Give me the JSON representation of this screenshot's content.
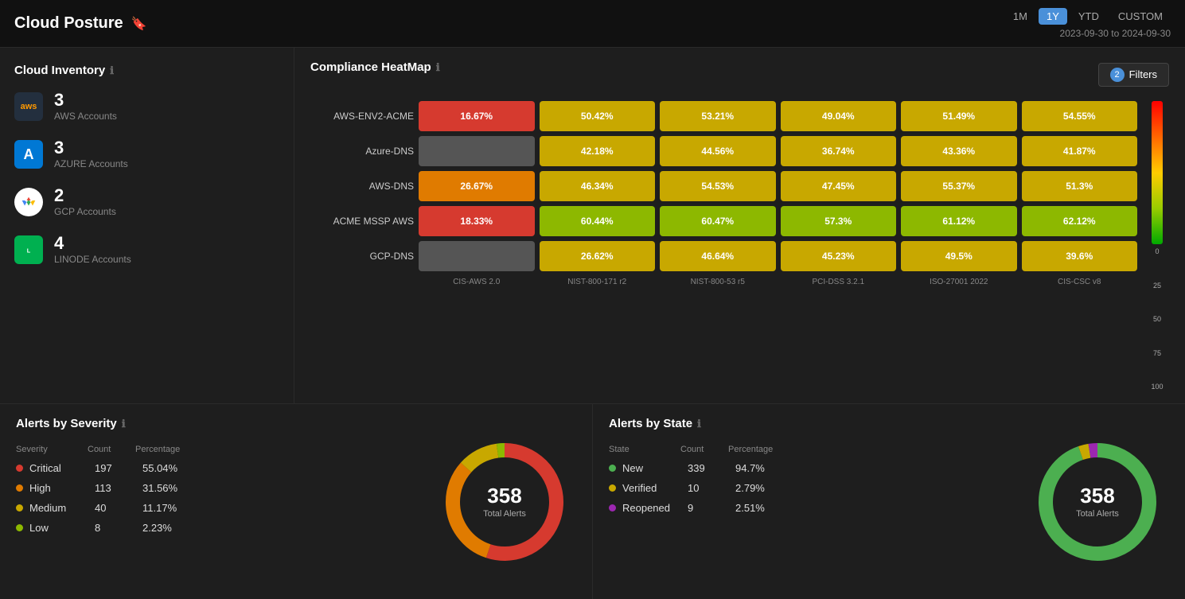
{
  "header": {
    "title": "Cloud Posture",
    "date_range": "2023-09-30 to 2024-09-30",
    "time_filters": [
      "1M",
      "1Y",
      "YTD",
      "CUSTOM"
    ],
    "active_filter": "1Y"
  },
  "cloud_inventory": {
    "title": "Cloud Inventory",
    "accounts": [
      {
        "id": "aws",
        "name": "AWS Accounts",
        "count": "3",
        "color": "#232f3e",
        "text_color": "#ff9900"
      },
      {
        "id": "azure",
        "name": "AZURE Accounts",
        "count": "3",
        "color": "#0078d4",
        "text_color": "#fff"
      },
      {
        "id": "gcp",
        "name": "GCP Accounts",
        "count": "2",
        "color": "#fff",
        "text_color": "#4285f4"
      },
      {
        "id": "linode",
        "name": "LINODE Accounts",
        "count": "4",
        "color": "#00b050",
        "text_color": "#fff"
      }
    ]
  },
  "compliance_heatmap": {
    "title": "Compliance HeatMap",
    "filters_label": "Filters",
    "filters_count": "2",
    "columns": [
      "CIS-AWS 2.0",
      "NIST-800-171 r2",
      "NIST-800-53 r5",
      "PCI-DSS 3.2.1",
      "ISO-27001 2022",
      "CIS-CSC v8"
    ],
    "rows": [
      {
        "label": "AWS-ENV2-ACME",
        "cells": [
          {
            "value": "16.67%",
            "color": "#d63a2f"
          },
          {
            "value": "50.42%",
            "color": "#c8a800"
          },
          {
            "value": "53.21%",
            "color": "#c8a800"
          },
          {
            "value": "49.04%",
            "color": "#c8a800"
          },
          {
            "value": "51.49%",
            "color": "#c8a800"
          },
          {
            "value": "54.55%",
            "color": "#c8a800"
          }
        ]
      },
      {
        "label": "Azure-DNS",
        "cells": [
          {
            "value": "",
            "color": "#555"
          },
          {
            "value": "42.18%",
            "color": "#c8a800"
          },
          {
            "value": "44.56%",
            "color": "#c8a800"
          },
          {
            "value": "36.74%",
            "color": "#c8a800"
          },
          {
            "value": "43.36%",
            "color": "#c8a800"
          },
          {
            "value": "41.87%",
            "color": "#c8a800"
          }
        ]
      },
      {
        "label": "AWS-DNS",
        "cells": [
          {
            "value": "26.67%",
            "color": "#e07b00"
          },
          {
            "value": "46.34%",
            "color": "#c8a800"
          },
          {
            "value": "54.53%",
            "color": "#c8a800"
          },
          {
            "value": "47.45%",
            "color": "#c8a800"
          },
          {
            "value": "55.37%",
            "color": "#c8a800"
          },
          {
            "value": "51.3%",
            "color": "#c8a800"
          }
        ]
      },
      {
        "label": "ACME MSSP AWS",
        "cells": [
          {
            "value": "18.33%",
            "color": "#d63a2f"
          },
          {
            "value": "60.44%",
            "color": "#8db800"
          },
          {
            "value": "60.47%",
            "color": "#8db800"
          },
          {
            "value": "57.3%",
            "color": "#8db800"
          },
          {
            "value": "61.12%",
            "color": "#8db800"
          },
          {
            "value": "62.12%",
            "color": "#8db800"
          }
        ]
      },
      {
        "label": "GCP-DNS",
        "cells": [
          {
            "value": "",
            "color": "#555"
          },
          {
            "value": "26.62%",
            "color": "#c8a800"
          },
          {
            "value": "46.64%",
            "color": "#c8a800"
          },
          {
            "value": "45.23%",
            "color": "#c8a800"
          },
          {
            "value": "49.5%",
            "color": "#c8a800"
          },
          {
            "value": "39.6%",
            "color": "#c8a800"
          }
        ]
      }
    ]
  },
  "alerts_severity": {
    "title": "Alerts by Severity",
    "col_severity": "Severity",
    "col_count": "Count",
    "col_percentage": "Percentage",
    "total": "358",
    "total_label": "Total Alerts",
    "rows": [
      {
        "label": "Critical",
        "count": "197",
        "pct": "55.04%",
        "color": "#d63a2f"
      },
      {
        "label": "High",
        "count": "113",
        "pct": "31.56%",
        "color": "#e07b00"
      },
      {
        "label": "Medium",
        "count": "40",
        "pct": "11.17%",
        "color": "#c8a800"
      },
      {
        "label": "Low",
        "count": "8",
        "pct": "2.23%",
        "color": "#8db800"
      }
    ],
    "donut": {
      "segments": [
        {
          "pct": 55.04,
          "color": "#d63a2f"
        },
        {
          "pct": 31.56,
          "color": "#e07b00"
        },
        {
          "pct": 11.17,
          "color": "#c8a800"
        },
        {
          "pct": 2.23,
          "color": "#8db800"
        }
      ]
    }
  },
  "alerts_state": {
    "title": "Alerts by State",
    "col_state": "State",
    "col_count": "Count",
    "col_percentage": "Percentage",
    "total": "358",
    "total_label": "Total Alerts",
    "rows": [
      {
        "label": "New",
        "count": "339",
        "pct": "94.7%",
        "color": "#4caf50"
      },
      {
        "label": "Verified",
        "count": "10",
        "pct": "2.79%",
        "color": "#c8a800"
      },
      {
        "label": "Reopened",
        "count": "9",
        "pct": "2.51%",
        "color": "#9c27b0"
      }
    ],
    "donut": {
      "segments": [
        {
          "pct": 94.7,
          "color": "#4caf50"
        },
        {
          "pct": 2.79,
          "color": "#c8a800"
        },
        {
          "pct": 2.51,
          "color": "#9c27b0"
        }
      ]
    }
  }
}
